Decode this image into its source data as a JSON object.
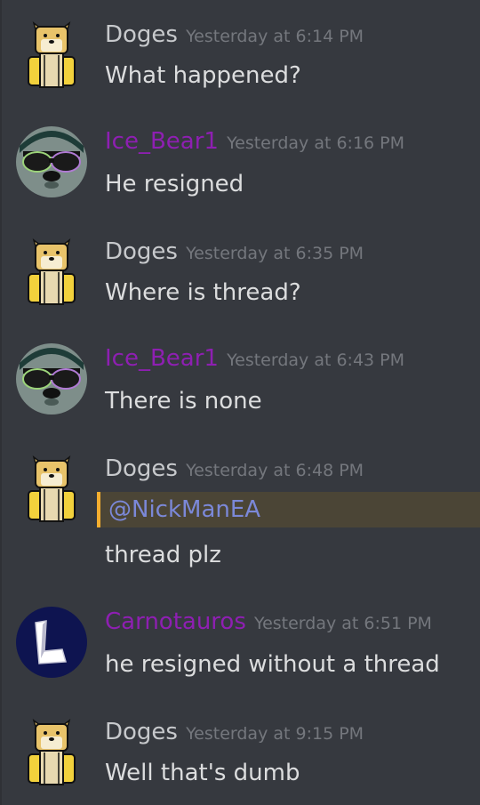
{
  "messages": [
    {
      "author": "Doges",
      "avatar": "doge-avatar",
      "timestamp": "Yesterday at 6:14 PM",
      "text": "What happened?"
    },
    {
      "author": "Ice_Bear1",
      "avatar": "ice-bear-avatar",
      "timestamp": "Yesterday at 6:16 PM",
      "text": "He resigned"
    },
    {
      "author": "Doges",
      "avatar": "doge-avatar",
      "timestamp": "Yesterday at 6:35 PM",
      "text": "Where is thread?"
    },
    {
      "author": "Ice_Bear1",
      "avatar": "ice-bear-avatar",
      "timestamp": "Yesterday at 6:43 PM",
      "text": "There is none"
    },
    {
      "author": "Doges",
      "avatar": "doge-avatar",
      "timestamp": "Yesterday at 6:48 PM",
      "mention": "@NickManEA",
      "text": "thread plz"
    },
    {
      "author": "Carnotauros",
      "avatar": "carnotauros-avatar",
      "timestamp": "Yesterday at 6:51 PM",
      "text": "he resigned without a thread"
    },
    {
      "author": "Doges",
      "avatar": "doge-avatar",
      "timestamp": "Yesterday at 9:15 PM",
      "text": "Well that's dumb"
    }
  ],
  "colors": {
    "background": "#36393f",
    "author_default": "#c7c9cc",
    "author_purple": "#8e1fb2",
    "timestamp": "#74777d",
    "message_text": "#dcddde",
    "mention_text": "#7b88d8",
    "mention_highlight": "#4b4536",
    "mention_bar": "#f4ae2f"
  }
}
